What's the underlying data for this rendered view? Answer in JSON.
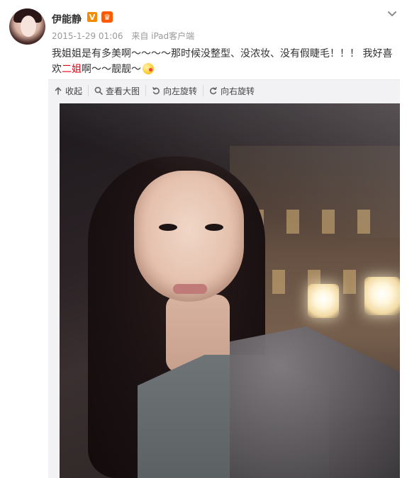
{
  "post": {
    "username": "伊能静",
    "timestamp": "2015-1-29 01:06",
    "source": "来自 iPad客户端",
    "content_parts": [
      "我姐姐是有多美啊～～～～那时候没整型、没浓妆、没有假睫毛！！！ 我好喜欢",
      "二姐",
      "啊～～靓靓～"
    ],
    "emoji_name": "cheeky-face-emoji",
    "highlight_color": "#e60012"
  },
  "media_toolbar": {
    "collapse_label": "收起",
    "view_large_label": "查看大图",
    "rotate_left_label": "向左旋转",
    "rotate_right_label": "向右旋转"
  },
  "icons": {
    "verified_badge": "V",
    "vip_badge": "crown-icon",
    "menu": "chevron-down-icon",
    "collapse": "collapse-up-icon",
    "zoom": "search-zoom-icon",
    "rotate_left": "rotate-left-icon",
    "rotate_right": "rotate-right-icon"
  },
  "colors": {
    "accent_orange": "#f48a00",
    "vip_orange": "#ff5a00",
    "toolbar_bg": "#f2f2f5"
  }
}
